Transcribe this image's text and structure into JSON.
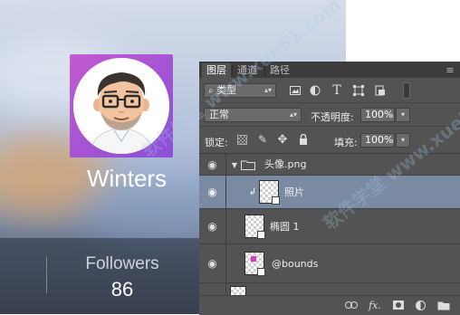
{
  "profile": {
    "username": "Winters",
    "followers_label": "Followers",
    "followers_count": "86"
  },
  "layers_panel": {
    "tabs": [
      {
        "label": "图层",
        "active": true
      },
      {
        "label": "通道",
        "active": false
      },
      {
        "label": "路径",
        "active": false
      }
    ],
    "filter": {
      "label": "类型",
      "icon": "search-icon"
    },
    "filter_icons": [
      "image-filter-icon",
      "adjustment-filter-icon",
      "text-filter-icon",
      "shape-filter-icon",
      "smart-object-filter-icon",
      "filter-toggle-icon"
    ],
    "blend_mode": "正常",
    "opacity_label": "不透明度:",
    "opacity_value": "100%",
    "lock_label": "锁定:",
    "lock_icons": [
      "lock-transparency-icon",
      "lock-brush-icon",
      "lock-move-icon",
      "lock-all-icon"
    ],
    "fill_label": "填充:",
    "fill_value": "100%",
    "layers": [
      {
        "name": "头像.png",
        "type": "group",
        "expanded": true
      },
      {
        "name": "照片",
        "type": "clipped-layer",
        "selected": true
      },
      {
        "name": "椭圆 1",
        "type": "shape"
      },
      {
        "name": "@bounds",
        "type": "shape"
      }
    ],
    "footer_icons": [
      "link-icon",
      "fx-icon",
      "add-mask-icon",
      "adjustment-icon",
      "new-group-icon"
    ],
    "fx_label": "fx."
  },
  "watermark": "软件学堂 www.xue51.com",
  "colors": {
    "panel_bg": "#535353",
    "selected_layer": "#7a8aa2",
    "avatar_frame": "#b556d3"
  }
}
